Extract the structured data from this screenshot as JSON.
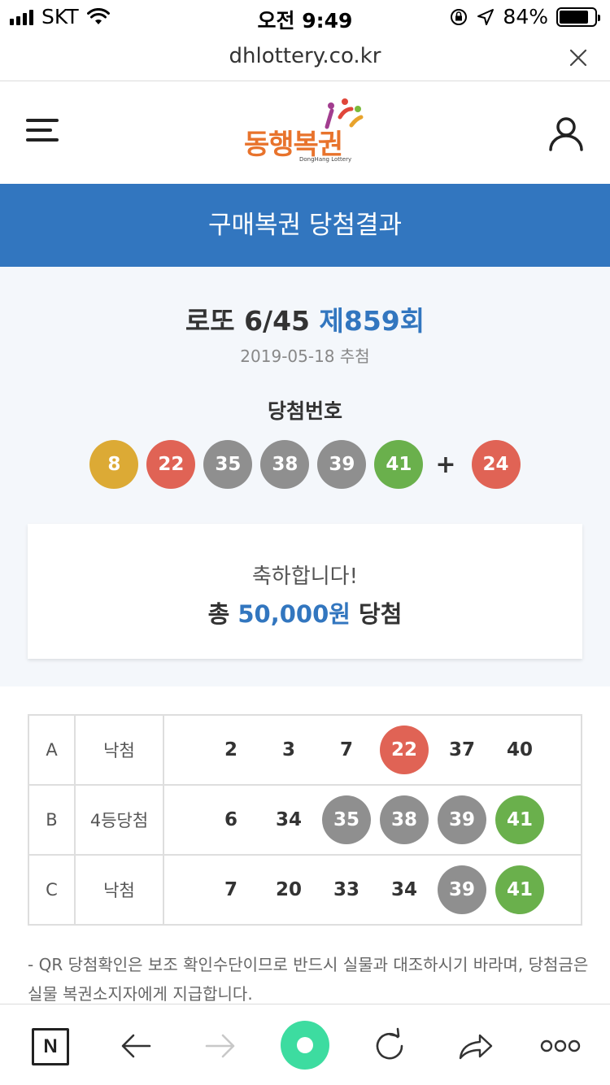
{
  "status_bar": {
    "carrier": "SKT",
    "time": "오전 9:49",
    "battery_pct": "84%",
    "battery_level": 0.84
  },
  "browser": {
    "url": "dhlottery.co.kr"
  },
  "site": {
    "logo_text": "동행복권",
    "logo_sub": "DongHang Lottery"
  },
  "page_title": "구매복권 당첨결과",
  "draw": {
    "game": "로또 6/45 ",
    "round": "제859회",
    "date": "2019-05-18 추첨",
    "win_label": "당첨번호",
    "numbers": [
      {
        "value": "8",
        "color": "#dcaa35"
      },
      {
        "value": "22",
        "color": "#e06355"
      },
      {
        "value": "35",
        "color": "#8f8f8f"
      },
      {
        "value": "38",
        "color": "#8f8f8f"
      },
      {
        "value": "39",
        "color": "#8f8f8f"
      },
      {
        "value": "41",
        "color": "#6ab04c"
      }
    ],
    "plus": "+",
    "bonus": {
      "value": "24",
      "color": "#e06355"
    }
  },
  "congrats": {
    "message": "축하합니다!",
    "prefix": "총 ",
    "amount": "50,000원",
    "suffix": " 당첨"
  },
  "tickets": [
    {
      "game": "A",
      "result": "낙첨",
      "numbers": [
        {
          "value": "2"
        },
        {
          "value": "3"
        },
        {
          "value": "7"
        },
        {
          "value": "22",
          "color": "#e06355"
        },
        {
          "value": "37"
        },
        {
          "value": "40"
        }
      ]
    },
    {
      "game": "B",
      "result": "4등당첨",
      "numbers": [
        {
          "value": "6"
        },
        {
          "value": "34"
        },
        {
          "value": "35",
          "color": "#8f8f8f"
        },
        {
          "value": "38",
          "color": "#8f8f8f"
        },
        {
          "value": "39",
          "color": "#8f8f8f"
        },
        {
          "value": "41",
          "color": "#6ab04c"
        }
      ]
    },
    {
      "game": "C",
      "result": "낙첨",
      "numbers": [
        {
          "value": "7"
        },
        {
          "value": "20"
        },
        {
          "value": "33"
        },
        {
          "value": "34"
        },
        {
          "value": "39",
          "color": "#8f8f8f"
        },
        {
          "value": "41",
          "color": "#6ab04c"
        }
      ]
    }
  ],
  "notice": "- QR 당첨확인은 보조 확인수단이므로 반드시 실물과 대조하시기 바라며, 당첨금은 실물 복권소지자에게 지급합니다.",
  "toolbar": {
    "n_label": "N"
  },
  "colors": {
    "brand_blue": "#3276bf",
    "logo_orange": "#e8732c"
  }
}
